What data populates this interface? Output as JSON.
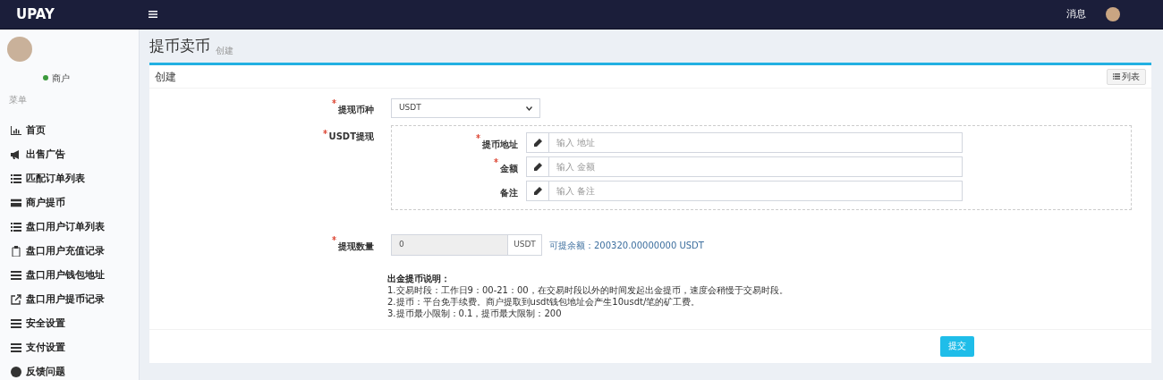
{
  "topbar": {
    "brand": "UPAY",
    "messages": "消息"
  },
  "sidebar": {
    "user_status": "商户",
    "menu_header": "菜单",
    "items": [
      {
        "label": "首页",
        "selected": false
      },
      {
        "label": "出售广告",
        "selected": false
      },
      {
        "label": "匹配订单列表",
        "selected": false
      },
      {
        "label": "商户提币",
        "selected": false
      },
      {
        "label": "盘口用户订单列表",
        "selected": false
      },
      {
        "label": "盘口用户充值记录",
        "selected": false
      },
      {
        "label": "盘口用户钱包地址",
        "selected": false
      },
      {
        "label": "盘口用户提币记录",
        "selected": false
      },
      {
        "label": "安全设置",
        "selected": false
      },
      {
        "label": "支付设置",
        "selected": false
      },
      {
        "label": "反馈问题",
        "selected": false
      }
    ]
  },
  "page": {
    "title": "提币卖币",
    "subtitle": "创建"
  },
  "card": {
    "title": "创建",
    "list_button": "列表",
    "currency": {
      "label": "提现币种",
      "required": true,
      "value": "USDT"
    },
    "usdt_group": {
      "label": "USDT提现",
      "required": true,
      "fields": [
        {
          "label": "提币地址",
          "required": true,
          "placeholder": "输入 地址"
        },
        {
          "label": "金额",
          "required": true,
          "placeholder": "输入 金额"
        },
        {
          "label": "备注",
          "required": false,
          "placeholder": "输入 备注"
        }
      ]
    },
    "quantity": {
      "label": "提现数量",
      "required": true,
      "value": "0",
      "unit": "USDT",
      "balance": "可提余额：200320.00000000 USDT"
    },
    "notes": {
      "title": "出金提币说明：",
      "lines": [
        "1.交易时段：工作日9：00-21：00，在交易时段以外的时间发起出金提币，速度会稍慢于交易时段。",
        "2.提币：平台免手续费。商户提取到usdt钱包地址会产生10usdt/笔的矿工费。",
        "3.提币最小限制：0.1，提币最大限制：200"
      ]
    },
    "submit": "提交"
  }
}
